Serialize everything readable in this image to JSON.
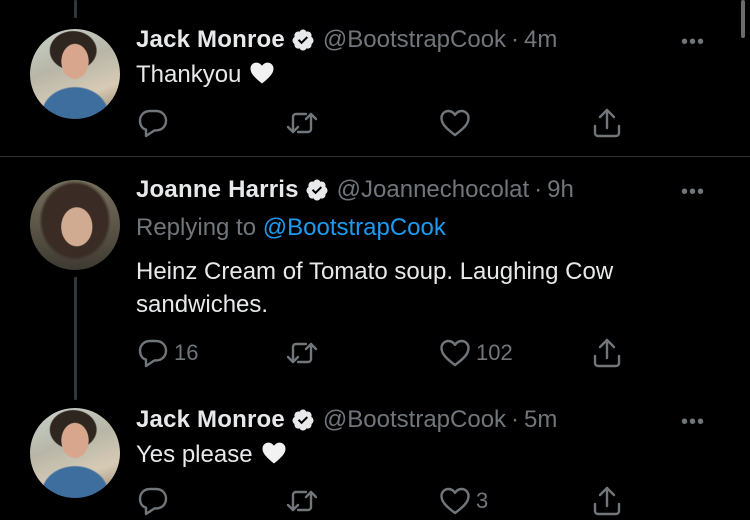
{
  "tweets": [
    {
      "name": "Jack Monroe",
      "handle": "@BootstrapCook",
      "separator": "·",
      "time": "4m",
      "text": "Thankyou",
      "emoji": "white-heart",
      "replies": "",
      "retweets": "",
      "likes": ""
    },
    {
      "name": "Joanne Harris",
      "handle": "@Joannechocolat",
      "separator": "·",
      "time": "9h",
      "reply_prefix": "Replying to",
      "reply_mention": "@BootstrapCook",
      "text_line1": "Heinz Cream of Tomato soup. Laughing Cow",
      "text_line2": "sandwiches.",
      "replies": "16",
      "retweets": "",
      "likes": "102"
    },
    {
      "name": "Jack Monroe",
      "handle": "@BootstrapCook",
      "separator": "·",
      "time": "5m",
      "text": "Yes please",
      "emoji": "white-heart",
      "replies": "",
      "retweets": "",
      "likes": "3"
    }
  ],
  "more_label": "•••",
  "colors": {
    "background": "#000000",
    "text_primary": "#e7e9ea",
    "text_secondary": "#71767b",
    "link": "#1d9bf0",
    "verified": "#e7e9ea",
    "divider": "#2f3336"
  },
  "icons": [
    "verified-badge-icon",
    "more-icon",
    "reply-icon",
    "retweet-icon",
    "like-icon",
    "share-icon",
    "white-heart-emoji"
  ]
}
